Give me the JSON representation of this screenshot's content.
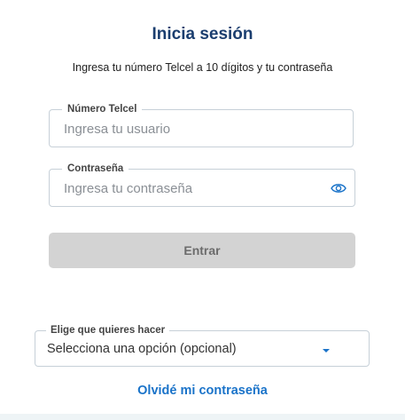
{
  "login": {
    "title": "Inicia sesión",
    "subtitle": "Ingresa tu número Telcel a 10 dígitos y tu contraseña",
    "phone_label": "Número Telcel",
    "phone_placeholder": "Ingresa tu usuario",
    "password_label": "Contraseña",
    "password_placeholder": "Ingresa tu contraseña",
    "enter_label": "Entrar",
    "options_label": "Elige que quieres hacer",
    "options_value": "Selecciona una opción (opcional)",
    "forgot_label": "Olvidé mi contraseña"
  },
  "icons": {
    "password_toggle": "eye-icon",
    "options_caret": "caret-down-icon"
  },
  "colors": {
    "title": "#1b3e6f",
    "link": "#1a73c9",
    "button_disabled": "#d3d3d3",
    "border": "#c7d0d8"
  }
}
